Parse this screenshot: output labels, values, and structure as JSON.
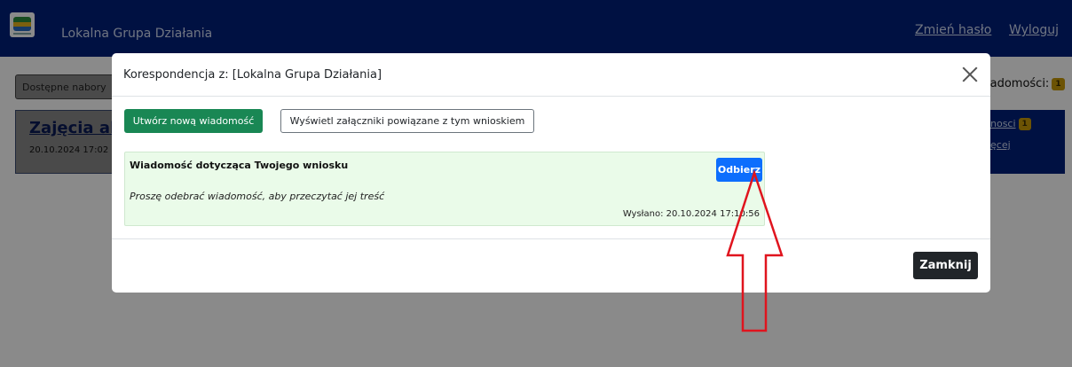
{
  "app": {
    "brand": "Lokalna Grupa Działania",
    "nav": {
      "change_password": "Zmień hasło",
      "logout": "Wyloguj"
    }
  },
  "background": {
    "filter_label": "Dostępne nabory",
    "messages_label": "iadomości:",
    "messages_count": "1",
    "card_title": "Zajęcia akty",
    "card_date": "20.10.2024 17:02 |",
    "right_links": [
      {
        "label": "nosci",
        "badge": "1"
      },
      {
        "label": "ęcej"
      }
    ]
  },
  "modal": {
    "title": "Korespondencja z: [Lokalna Grupa Działania]",
    "new_message_button": "Utwórz nową wiadomość",
    "attachments_button": "Wyświetl załączniki powiązane z tym wnioskiem",
    "message": {
      "title": "Wiadomość dotycząca Twojego wniosku",
      "receive_button": "Odbierz",
      "body": "Proszę odebrać wiadomość, aby przeczytać jej treść",
      "sent": "Wysłano: 20.10.2024 17:10:56"
    },
    "close_button": "Zamknij"
  },
  "colors": {
    "navbar": "#00207a",
    "success": "#198754",
    "primary": "#0d6efd",
    "dark": "#212529",
    "message_bg": "#eafbe9",
    "annotation_arrow": "#e0141e",
    "badge": "#c89a08"
  },
  "icons": {
    "close": "close-icon",
    "logo": "logo-icon",
    "annotation": "up-arrow-icon"
  }
}
